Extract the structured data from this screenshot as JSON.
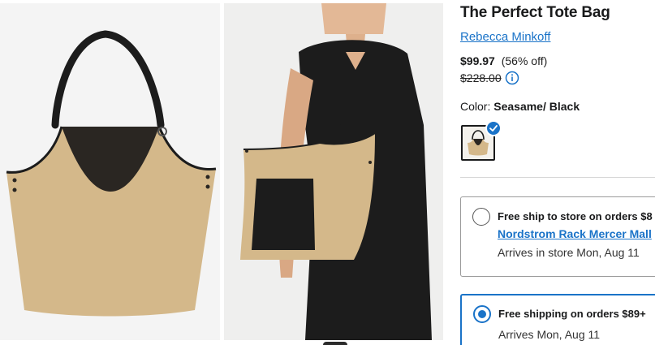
{
  "gallery": {
    "images": [
      {
        "name": "product-photo-bag"
      },
      {
        "name": "product-photo-model"
      }
    ]
  },
  "product": {
    "title": "The Perfect Tote Bag",
    "brand": "Rebecca Minkoff",
    "price": "$99.97",
    "discount": "(56% off)",
    "original_price": "$228.00",
    "color_label": "Color:",
    "color_name": "Seasame/ Black"
  },
  "shipping": {
    "options": [
      {
        "title": "Free ship to store on orders $8",
        "store_link": "Nordstrom Rack Mercer Mall",
        "arrival": "Arrives in store Mon, Aug 11",
        "selected": false
      },
      {
        "title": "Free shipping on orders $89+",
        "arrival": "Arrives Mon, Aug 11",
        "selected": true
      }
    ]
  },
  "colors": {
    "accent": "#1a73c8",
    "bag_tan": "#d4b88a",
    "strap_black": "#1c1c1c"
  }
}
